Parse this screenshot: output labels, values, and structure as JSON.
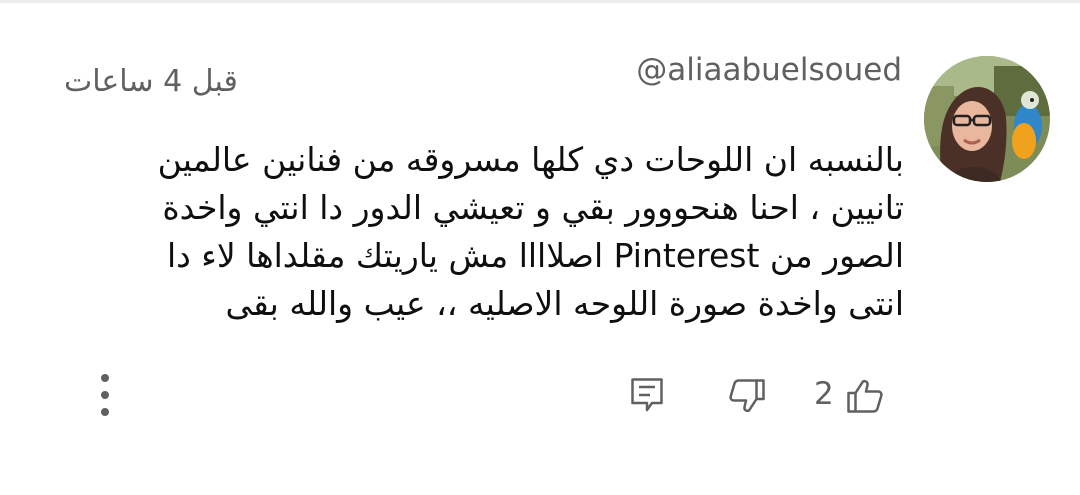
{
  "comment": {
    "author": "@aliaabuelsoued",
    "timestamp": "قبل 4 ساعات",
    "text_lines": [
      "بالنسبه ان اللوحات دي كلها مسروقه من فنانين عالمين",
      "تانيين ، احنا هنحووور بقي و تعيشي الدور دا انتي واخدة",
      "الصور من Pinterest  اصلاااا مش ياريتك مقلداها لاء دا",
      "انتى واخدة صورة اللوحه الاصليه ،، عيب والله بقى"
    ]
  },
  "actions": {
    "like_count": "2",
    "like_icon": "thumb-up-icon",
    "dislike_icon": "thumb-down-icon",
    "reply_icon": "comment-icon",
    "more_icon": "more-vertical-icon"
  },
  "colors": {
    "text_primary": "#0f0f0f",
    "text_secondary": "#606060"
  }
}
